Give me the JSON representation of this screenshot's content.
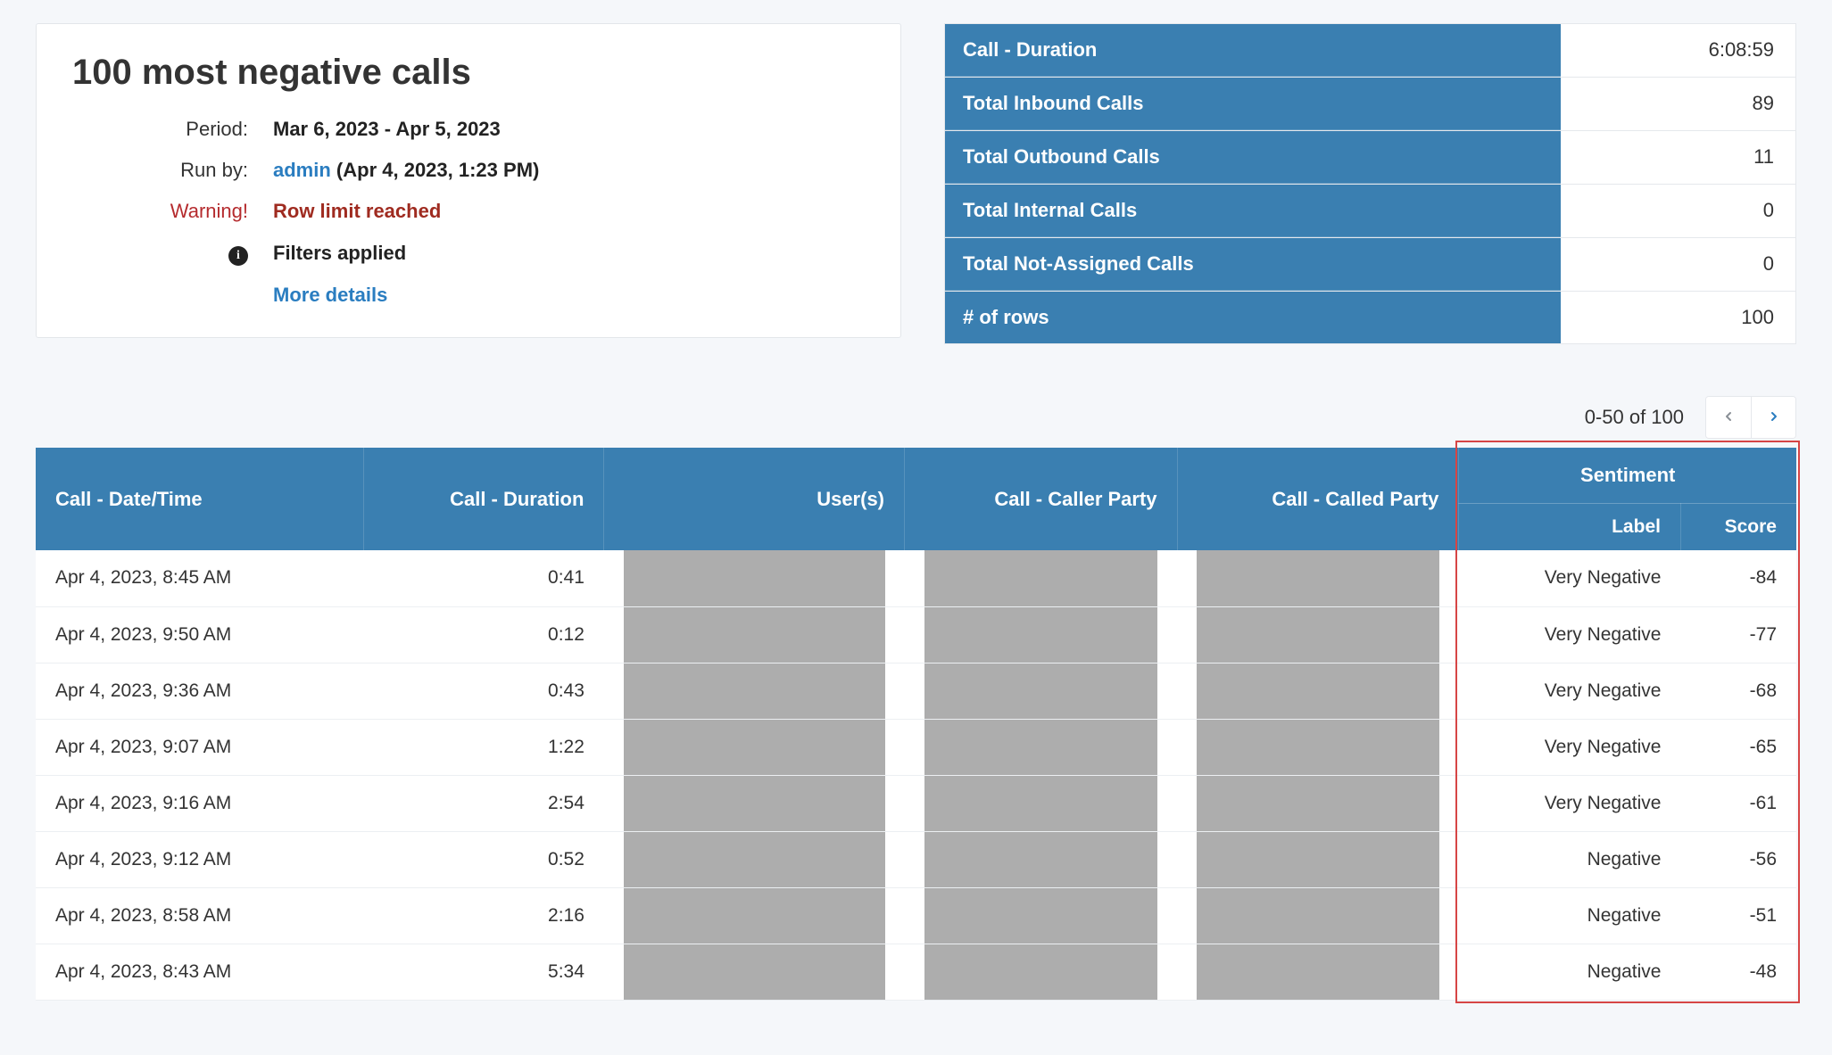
{
  "report": {
    "title": "100 most negative calls",
    "labels": {
      "period": "Period:",
      "run_by": "Run by:",
      "warning": "Warning!",
      "filters": "Filters applied",
      "more": "More details"
    },
    "period": "Mar 6, 2023 - Apr 5, 2023",
    "run_by_user": "admin",
    "run_by_time": "(Apr 4, 2023, 1:23 PM)",
    "warning_text": "Row limit reached"
  },
  "summary": [
    {
      "name": "Call - Duration",
      "value": "6:08:59"
    },
    {
      "name": "Total Inbound Calls",
      "value": "89"
    },
    {
      "name": "Total Outbound Calls",
      "value": "11"
    },
    {
      "name": "Total Internal Calls",
      "value": "0"
    },
    {
      "name": "Total Not-Assigned Calls",
      "value": "0"
    },
    {
      "name": "# of rows",
      "value": "100"
    }
  ],
  "pager": {
    "range": "0-50 of 100"
  },
  "columns": {
    "datetime": "Call - Date/Time",
    "duration": "Call - Duration",
    "users": "User(s)",
    "caller": "Call - Caller Party",
    "called": "Call - Called Party",
    "sentiment": "Sentiment",
    "label": "Label",
    "score": "Score"
  },
  "rows": [
    {
      "dt": "Apr 4, 2023, 8:45 AM",
      "dur": "0:41",
      "label": "Very Negative",
      "score": "-84"
    },
    {
      "dt": "Apr 4, 2023, 9:50 AM",
      "dur": "0:12",
      "label": "Very Negative",
      "score": "-77"
    },
    {
      "dt": "Apr 4, 2023, 9:36 AM",
      "dur": "0:43",
      "label": "Very Negative",
      "score": "-68"
    },
    {
      "dt": "Apr 4, 2023, 9:07 AM",
      "dur": "1:22",
      "label": "Very Negative",
      "score": "-65"
    },
    {
      "dt": "Apr 4, 2023, 9:16 AM",
      "dur": "2:54",
      "label": "Very Negative",
      "score": "-61"
    },
    {
      "dt": "Apr 4, 2023, 9:12 AM",
      "dur": "0:52",
      "label": "Negative",
      "score": "-56"
    },
    {
      "dt": "Apr 4, 2023, 8:58 AM",
      "dur": "2:16",
      "label": "Negative",
      "score": "-51"
    },
    {
      "dt": "Apr 4, 2023, 8:43 AM",
      "dur": "5:34",
      "label": "Negative",
      "score": "-48"
    }
  ]
}
